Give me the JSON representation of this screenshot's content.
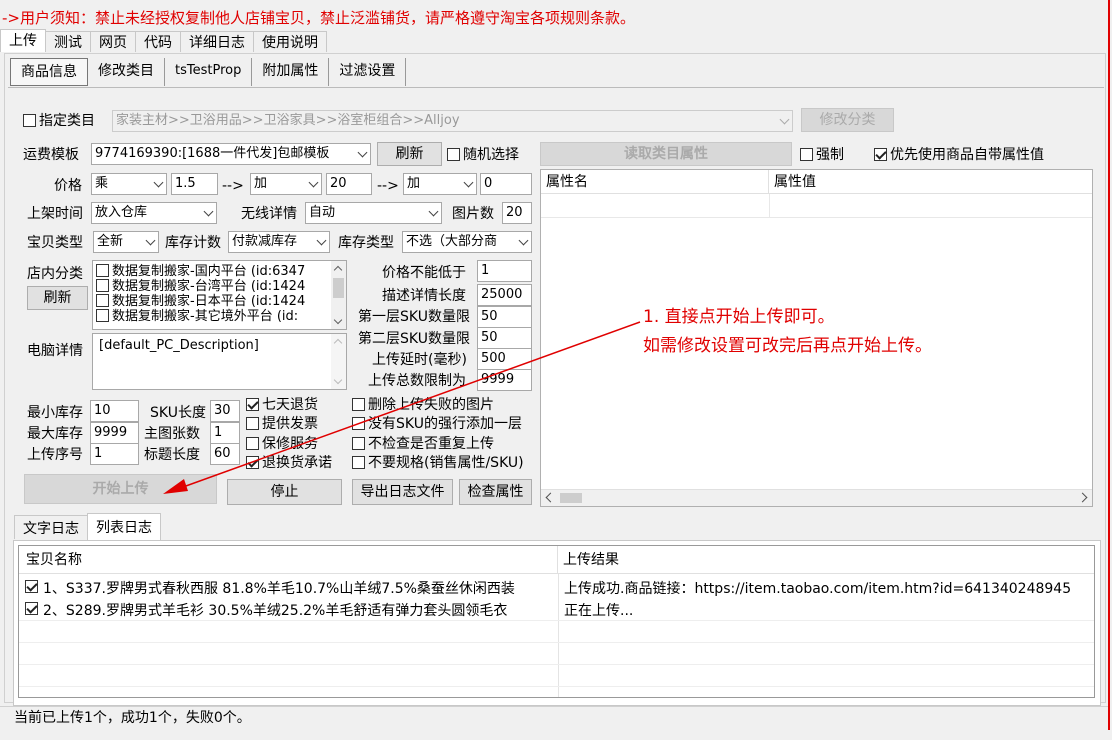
{
  "notice": "->用户须知：禁止未经授权复制他人店铺宝贝，禁止泛滥铺货，请严格遵守淘宝各项规则条款。",
  "top_tabs": [
    "上传",
    "测试",
    "网页",
    "代码",
    "详细日志",
    "使用说明"
  ],
  "sub_tabs": [
    "商品信息",
    "修改类目",
    "tsTestProp",
    "附加属性",
    "过滤设置"
  ],
  "category": {
    "label": "指定类目",
    "value": "家装主材>>卫浴用品>>卫浴家具>>浴室柜组合>>Alljoy",
    "button": "修改分类"
  },
  "shipping": {
    "label": "运费模板",
    "value": "9774169390:[1688一件代发]包邮模板",
    "refresh": "刷新",
    "random": "随机选择"
  },
  "read_attr_button": "读取类目属性",
  "force_label": "强制",
  "prefer_label": "优先使用商品自带属性值",
  "price": {
    "label": "价格",
    "op1": "乘",
    "v1": "1.5",
    "arrow": "-->",
    "op2": "加",
    "v2": "20",
    "op3": "加",
    "v3": "0"
  },
  "listing_time": {
    "label": "上架时间",
    "value": "放入仓库"
  },
  "wireless": {
    "label": "无线详情",
    "value": "自动"
  },
  "image_count": {
    "label": "图片数",
    "value": "20"
  },
  "item_type": {
    "label": "宝贝类型",
    "value": "全新"
  },
  "stock_count": {
    "label": "库存计数",
    "value": "付款减库存"
  },
  "stock_type": {
    "label": "库存类型",
    "value": "不选（大部分商"
  },
  "shop_category": {
    "label": "店内分类",
    "refresh": "刷新",
    "items": [
      "数据复制搬家-国内平台 (id:6347",
      "数据复制搬家-台湾平台 (id:1424",
      "数据复制搬家-日本平台 (id:1424",
      "数据复制搬家-其它境外平台 (id:"
    ]
  },
  "pc_detail": {
    "label": "电脑详情",
    "value": "[default_PC_Description]"
  },
  "limits": [
    {
      "label": "价格不能低于",
      "value": "1"
    },
    {
      "label": "描述详情长度",
      "value": "25000"
    },
    {
      "label": "第一层SKU数量限",
      "value": "50"
    },
    {
      "label": "第二层SKU数量限",
      "value": "50"
    },
    {
      "label": "上传延时(毫秒)",
      "value": "500"
    },
    {
      "label": "上传总数限制为",
      "value": "9999"
    }
  ],
  "stock": {
    "min_label": "最小库存",
    "min": "10",
    "max_label": "最大库存",
    "max": "9999",
    "seq_label": "上传序号",
    "seq": "1"
  },
  "sku_len": {
    "label": "SKU长度",
    "value": "30"
  },
  "main_img": {
    "label": "主图张数",
    "value": "1"
  },
  "title_len": {
    "label": "标题长度",
    "value": "60"
  },
  "services": [
    {
      "label": "七天退货",
      "checked": true
    },
    {
      "label": "提供发票",
      "checked": false
    },
    {
      "label": "保修服务",
      "checked": false
    },
    {
      "label": "退换货承诺",
      "checked": true
    }
  ],
  "options": [
    {
      "label": "删除上传失败的图片",
      "checked": false
    },
    {
      "label": "没有SKU的强行添加一层",
      "checked": false
    },
    {
      "label": "不检查是否重复上传",
      "checked": false
    },
    {
      "label": "不要规格(销售属性/SKU)",
      "checked": false
    }
  ],
  "buttons": {
    "start": "开始上传",
    "stop": "停止",
    "export_log": "导出日志文件",
    "check_attr": "检查属性"
  },
  "attr_grid": {
    "col1": "属性名",
    "col2": "属性值"
  },
  "annotation": {
    "line1": "1. 直接点开始上传即可。",
    "line2": "如需修改设置可改完后再点开始上传。"
  },
  "log_tabs": [
    "文字日志",
    "列表日志"
  ],
  "log_grid": {
    "col1": "宝贝名称",
    "col2": "上传结果",
    "rows": [
      {
        "name": "1、S337.罗牌男式春秋西服 81.8%羊毛10.7%山羊绒7.5%桑蚕丝休闲西装",
        "result": "上传成功.商品链接：https://item.taobao.com/item.htm?id=641340248945"
      },
      {
        "name": "2、S289.罗牌男式羊毛衫 30.5%羊绒25.2%羊毛舒适有弹力套头圆领毛衣",
        "result": "正在上传..."
      }
    ]
  },
  "status": "当前已上传1个，成功1个，失败0个。",
  "colors": {
    "accent_red": "#e00000"
  }
}
